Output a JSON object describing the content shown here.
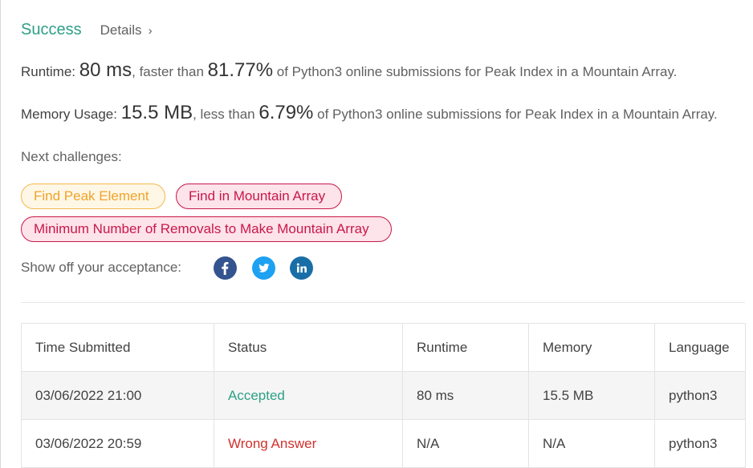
{
  "header": {
    "status": "Success",
    "details_label": "Details",
    "details_chevron": "›"
  },
  "runtime": {
    "label": "Runtime:",
    "value": "80 ms",
    "mid": ", faster than",
    "percent": "81.77%",
    "suffix": "of Python3 online submissions for Peak Index in a Mountain Array."
  },
  "memory": {
    "label": "Memory Usage:",
    "value": "15.5 MB",
    "mid": ", less than",
    "percent": "6.79%",
    "suffix": "of Python3 online submissions for Peak Index in a Mountain Array."
  },
  "next_challenges": {
    "label": "Next challenges:",
    "items": [
      {
        "title": "Find Peak Element",
        "difficulty_color": "#f0a32a"
      },
      {
        "title": "Find in Mountain Array",
        "difficulty_color": "#c9184a"
      },
      {
        "title": "Minimum Number of Removals to Make Mountain Array",
        "difficulty_color": "#c9184a"
      }
    ]
  },
  "share": {
    "label": "Show off your acceptance:",
    "icons": [
      "facebook-icon",
      "twitter-icon",
      "linkedin-icon"
    ]
  },
  "submissions": {
    "columns": [
      "Time Submitted",
      "Status",
      "Runtime",
      "Memory",
      "Language"
    ],
    "rows": [
      {
        "time": "03/06/2022 21:00",
        "status": "Accepted",
        "runtime": "80 ms",
        "memory": "15.5 MB",
        "language": "python3"
      },
      {
        "time": "03/06/2022 20:59",
        "status": "Wrong Answer",
        "runtime": "N/A",
        "memory": "N/A",
        "language": "python3"
      }
    ]
  },
  "colors": {
    "accepted": "#2e9f86",
    "wrong_answer": "#d0312d"
  }
}
